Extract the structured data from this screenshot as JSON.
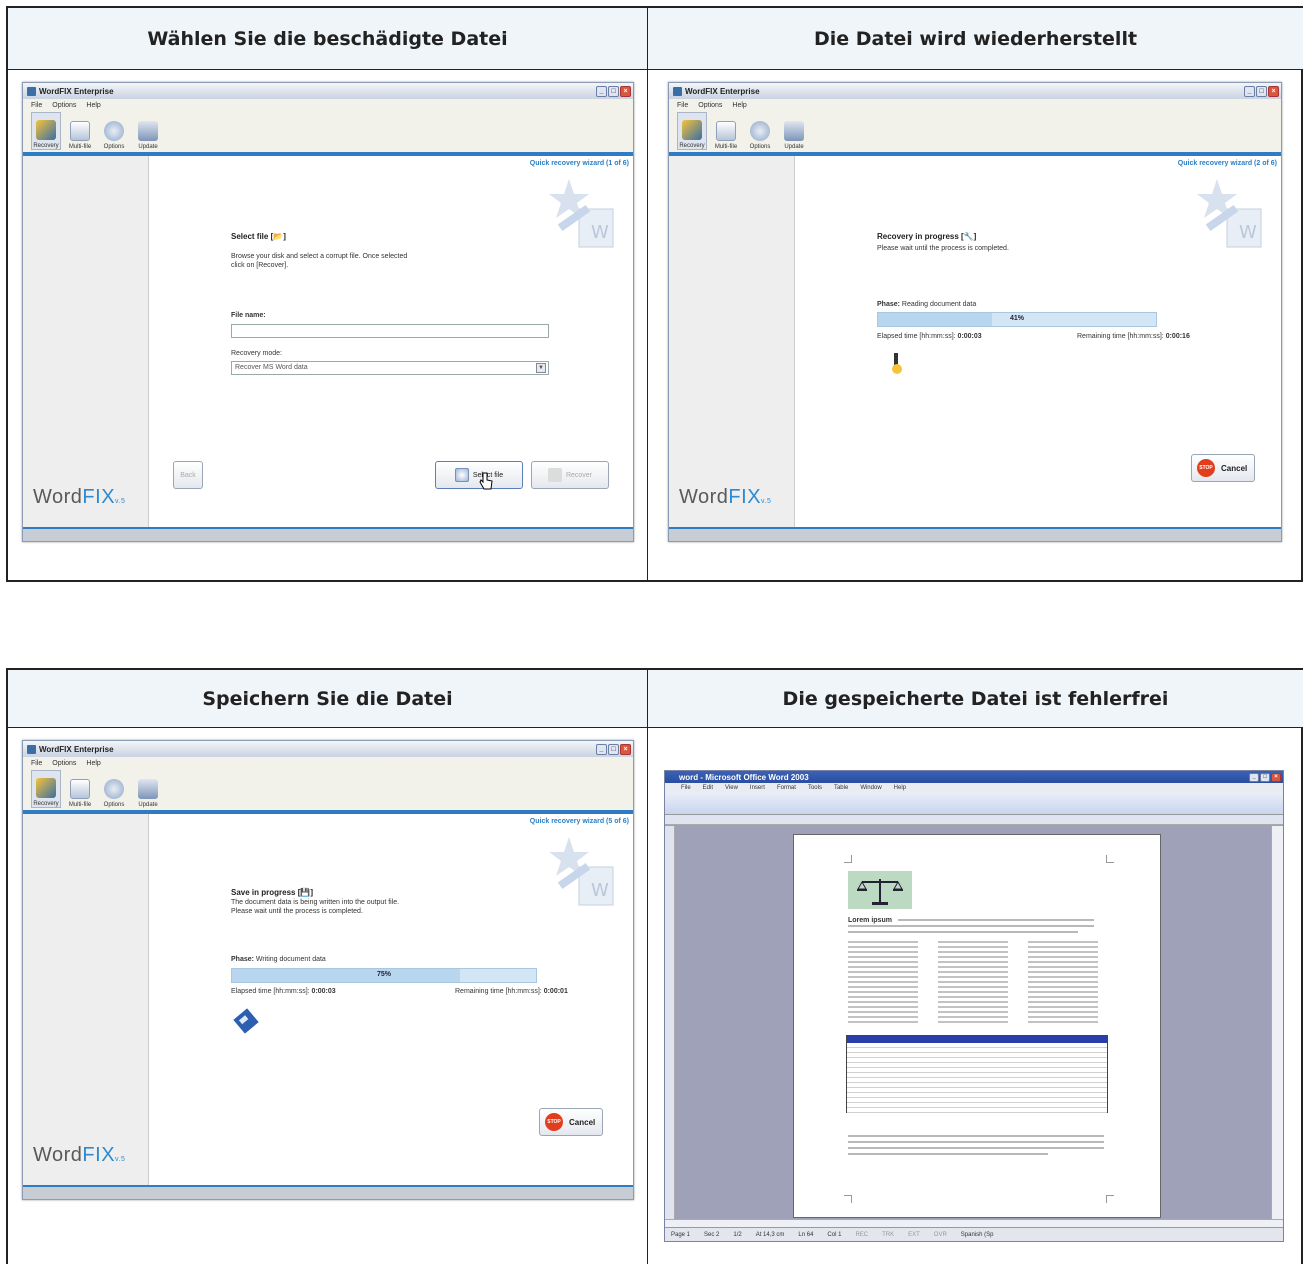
{
  "headers": {
    "step1": "Wählen Sie die beschädigte Datei",
    "step2": "Die Datei wird wiederherstellt",
    "step3": "Speichern Sie die Datei",
    "step4": "Die gespeicherte Datei ist fehlerfrei"
  },
  "app": {
    "title": "WordFIX Enterprise",
    "menu": [
      "File",
      "Options",
      "Help"
    ],
    "toolbar": [
      "Recovery",
      "Multi-file",
      "Options",
      "Update"
    ],
    "logo_word": "Word",
    "logo_fix": "FIX",
    "logo_ver": "v.5"
  },
  "screen1": {
    "wizard": "Quick recovery wizard (1 of 6)",
    "title": "Select file",
    "text": "Browse your disk and select a corrupt file. Once selected click on [Recover].",
    "file_label": "File name:",
    "file_value": "",
    "mode_label": "Recovery mode:",
    "mode_value": "Recover MS Word data",
    "back": "Back",
    "select": "Select file",
    "recover": "Recover"
  },
  "screen2": {
    "wizard": "Quick recovery wizard (2 of 6)",
    "title": "Recovery in progress",
    "text": "Please wait until the process is completed.",
    "phase_label": "Phase:",
    "phase_value": "Reading document data",
    "percent": "41%",
    "progress": 0.41,
    "elapsed_label": "Elapsed time [hh:mm:ss]:",
    "elapsed": "0:00:03",
    "remaining_label": "Remaining time [hh:mm:ss]:",
    "remaining": "0:00:16",
    "cancel": "Cancel"
  },
  "screen3": {
    "wizard": "Quick recovery wizard (5 of 6)",
    "title": "Save in progress",
    "text1": "The document data is being written into the output file.",
    "text2": "Please wait until the process is completed.",
    "phase_label": "Phase:",
    "phase_value": "Writing document data",
    "percent": "75%",
    "progress": 0.75,
    "elapsed_label": "Elapsed time [hh:mm:ss]:",
    "elapsed": "0:00:03",
    "remaining_label": "Remaining time [hh:mm:ss]:",
    "remaining": "0:00:01",
    "cancel": "Cancel"
  },
  "word": {
    "title": "word - Microsoft Office Word 2003",
    "menu": [
      "File",
      "Edit",
      "View",
      "Insert",
      "Format",
      "Tools",
      "Table",
      "Window",
      "Help"
    ],
    "heading": "Lorem ipsum",
    "status": [
      "Page 1",
      "Sec 2",
      "1/2",
      "At 14,3 cm",
      "Ln 64",
      "Col 1",
      "REC",
      "TRK",
      "EXT",
      "OVR",
      "Spanish (Sp"
    ]
  },
  "colors": {
    "accent": "#2e7cc4",
    "stop": "#e23e1e",
    "word_title": "#2a4ea0",
    "table_header": "#2c3fa8"
  }
}
